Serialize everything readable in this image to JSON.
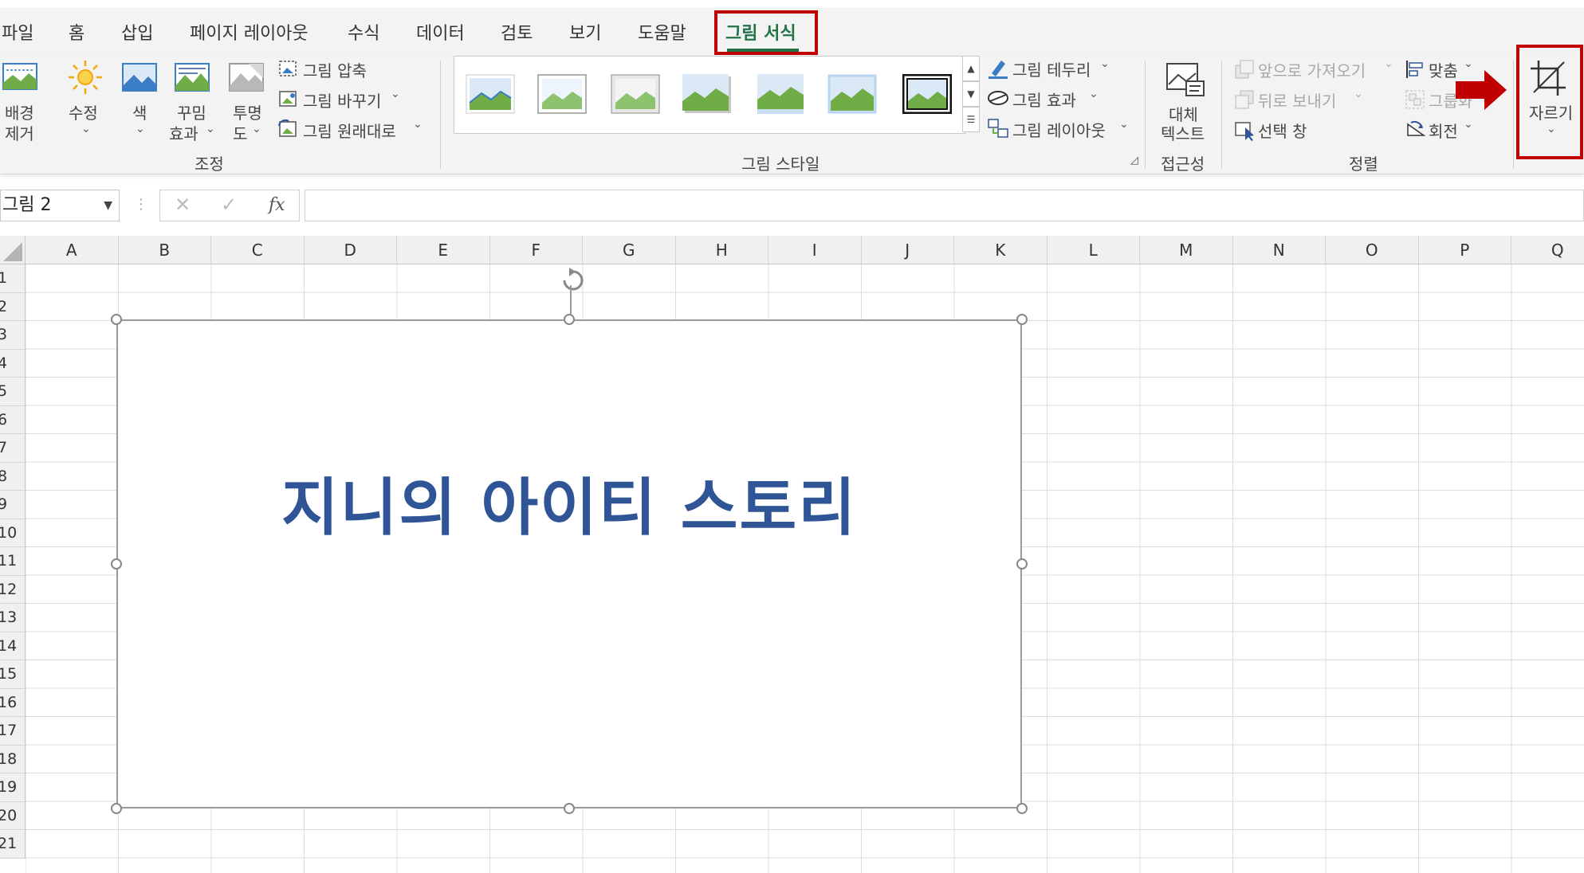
{
  "tabs": [
    "파일",
    "홈",
    "삽입",
    "페이지 레이아웃",
    "수식",
    "데이터",
    "검토",
    "보기",
    "도움말",
    "그림 서식"
  ],
  "active_tab": "그림 서식",
  "ribbon": {
    "adjust": {
      "remove_bg": [
        "배경",
        "제거"
      ],
      "corrections": "수정",
      "color": "색",
      "artistic": [
        "꾸밈",
        "효과"
      ],
      "transparency": [
        "투명",
        "도"
      ],
      "compress": "그림 압축",
      "change": "그림 바꾸기",
      "reset": "그림 원래대로",
      "group_label": "조정"
    },
    "styles": {
      "border": "그림 테두리",
      "effects": "그림 효과",
      "layout": "그림 레이아웃",
      "group_label": "그림 스타일"
    },
    "accessibility": {
      "alt_text": [
        "대체",
        "텍스트"
      ],
      "group_label": "접근성"
    },
    "arrange": {
      "bring_forward": "앞으로 가져오기",
      "send_backward": "뒤로 보내기",
      "selection_pane": "선택 창",
      "align": "맞춤",
      "group": "그룹화",
      "rotate": "회전",
      "group_label": "정렬"
    },
    "crop": "자르기"
  },
  "formula_bar": {
    "name_box": "그림 2",
    "cancel": "✕",
    "enter": "✓",
    "fx": "fx",
    "value": ""
  },
  "columns": [
    "A",
    "B",
    "C",
    "D",
    "E",
    "F",
    "G",
    "H",
    "I",
    "J",
    "K",
    "L",
    "M",
    "N",
    "O",
    "P",
    "Q"
  ],
  "rows": [
    "1",
    "2",
    "3",
    "4",
    "5",
    "6",
    "7",
    "8",
    "9",
    "10",
    "11",
    "12",
    "13",
    "14",
    "15",
    "16",
    "17",
    "18",
    "19",
    "20",
    "21"
  ],
  "picture_text": "지니의 아이티 스토리",
  "colors": {
    "accent": "#217346",
    "highlight": "#c00000",
    "title_text": "#2f5597",
    "arrow": "#c00000"
  }
}
